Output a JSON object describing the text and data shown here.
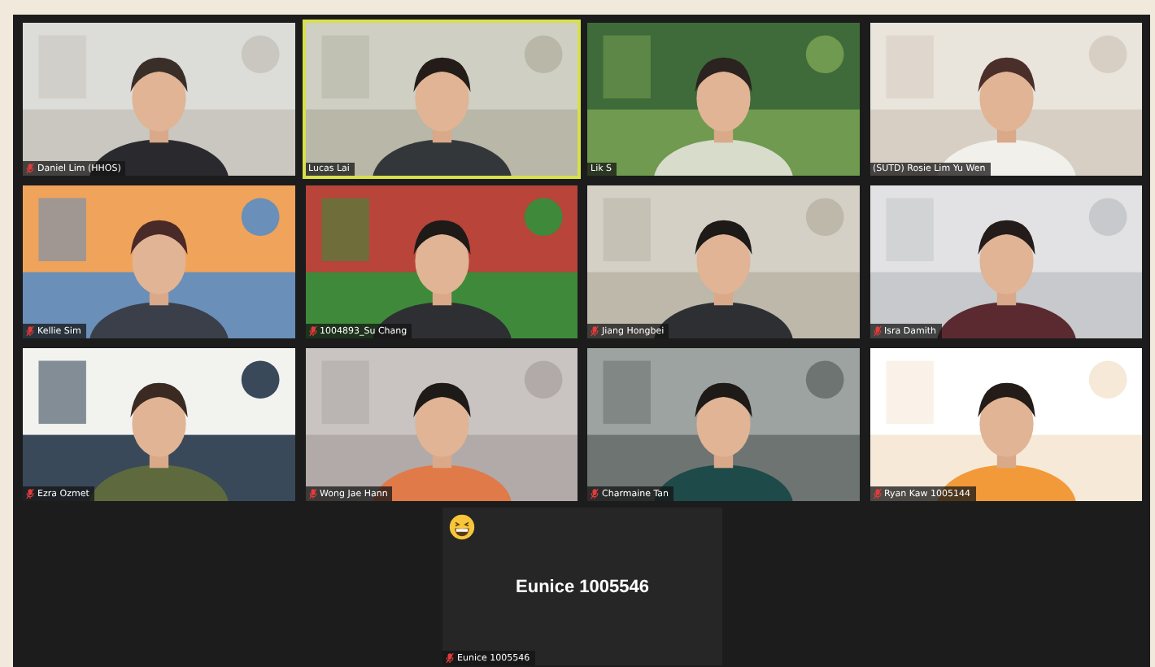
{
  "tiles": [
    {
      "name": "Daniel Lim (HHOS)",
      "muted": true,
      "active_speaker": false
    },
    {
      "name": "Lucas Lai",
      "muted": false,
      "active_speaker": true
    },
    {
      "name": "Lik S",
      "muted": false,
      "active_speaker": false
    },
    {
      "name": "(SUTD) Rosie Lim Yu Wen",
      "muted": false,
      "active_speaker": false
    },
    {
      "name": "Kellie Sim",
      "muted": true,
      "active_speaker": false
    },
    {
      "name": "1004893_Su Chang",
      "muted": true,
      "active_speaker": false
    },
    {
      "name": "Jiang Hongbei",
      "muted": true,
      "active_speaker": false
    },
    {
      "name": "Isra Damith",
      "muted": true,
      "active_speaker": false
    },
    {
      "name": "Ezra Ozmet",
      "muted": true,
      "active_speaker": false
    },
    {
      "name": "Wong Jae Hann",
      "muted": true,
      "active_speaker": false
    },
    {
      "name": "Charmaine Tan",
      "muted": true,
      "active_speaker": false
    },
    {
      "name": "Ryan Kaw 1005144",
      "muted": true,
      "active_speaker": false
    }
  ],
  "camera_off_tile": {
    "display_name": "Eunice 1005546",
    "name": "Eunice 1005546",
    "muted": true,
    "reaction": true
  }
}
